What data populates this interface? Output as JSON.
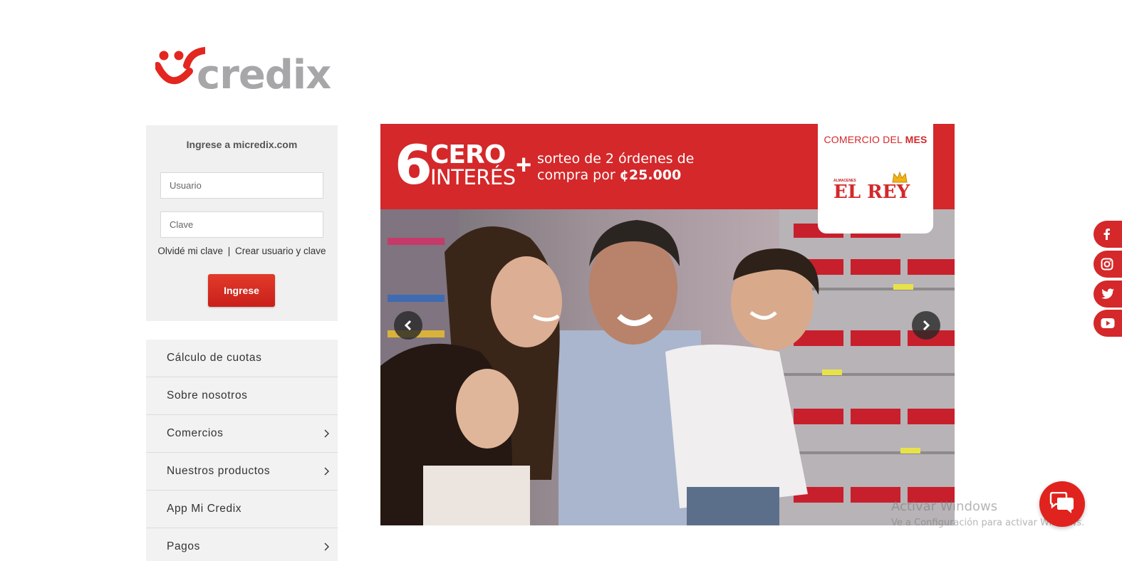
{
  "brand": {
    "logo_text": "credix",
    "accent": "#d4282a"
  },
  "login": {
    "title": "Ingrese a micredix.com",
    "user_placeholder": "Usuario",
    "pass_placeholder": "Clave",
    "forgot": "Olvidé mi clave",
    "separator": "|",
    "create": "Crear usuario y clave",
    "submit": "Ingrese"
  },
  "menu": {
    "items": [
      {
        "label": "Cálculo de cuotas",
        "has_submenu": false
      },
      {
        "label": "Sobre nosotros",
        "has_submenu": false
      },
      {
        "label": "Comercios",
        "has_submenu": true
      },
      {
        "label": "Nuestros productos",
        "has_submenu": true
      },
      {
        "label": "App Mi Credix",
        "has_submenu": false
      },
      {
        "label": "Pagos",
        "has_submenu": true
      }
    ]
  },
  "banner": {
    "number": "6",
    "cero": "CERO",
    "interes": "INTERÉS",
    "plus": "+",
    "promo_line1": "sorteo de 2 órdenes de",
    "promo_line2_prefix": "compra por ",
    "promo_amount": "¢25.000",
    "mes_prefix": "COMERCIO DEL ",
    "mes_bold": "MES",
    "store_small": "ALMACENES",
    "store_name": "EL REY"
  },
  "social": [
    "facebook-icon",
    "instagram-icon",
    "twitter-icon",
    "youtube-icon"
  ],
  "watermark": {
    "line1": "Activar Windows",
    "line2": "Ve a Configuración para activar Windows."
  }
}
